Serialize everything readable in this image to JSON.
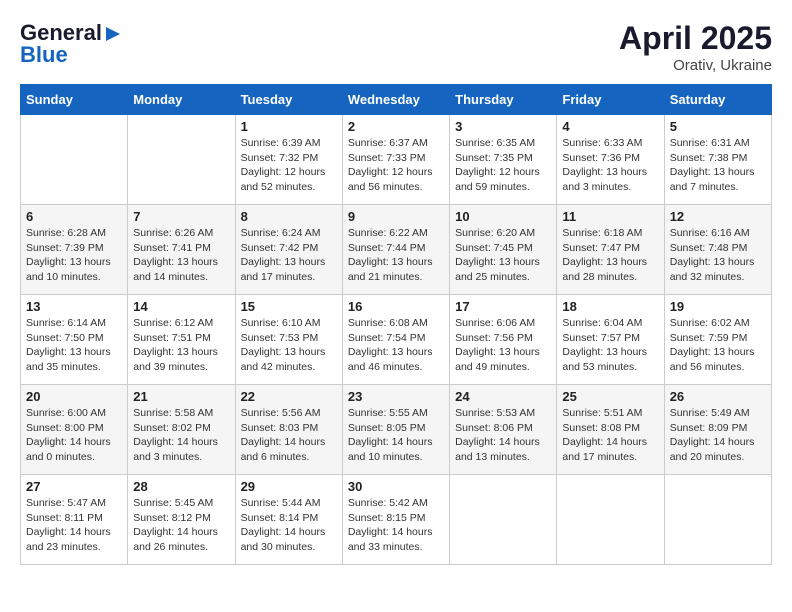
{
  "logo": {
    "general": "General",
    "blue": "Blue"
  },
  "title": "April 2025",
  "location": "Orativ, Ukraine",
  "days": [
    "Sunday",
    "Monday",
    "Tuesday",
    "Wednesday",
    "Thursday",
    "Friday",
    "Saturday"
  ],
  "weeks": [
    [
      {
        "day": "",
        "content": ""
      },
      {
        "day": "",
        "content": ""
      },
      {
        "day": "1",
        "content": "Sunrise: 6:39 AM\nSunset: 7:32 PM\nDaylight: 12 hours\nand 52 minutes."
      },
      {
        "day": "2",
        "content": "Sunrise: 6:37 AM\nSunset: 7:33 PM\nDaylight: 12 hours\nand 56 minutes."
      },
      {
        "day": "3",
        "content": "Sunrise: 6:35 AM\nSunset: 7:35 PM\nDaylight: 12 hours\nand 59 minutes."
      },
      {
        "day": "4",
        "content": "Sunrise: 6:33 AM\nSunset: 7:36 PM\nDaylight: 13 hours\nand 3 minutes."
      },
      {
        "day": "5",
        "content": "Sunrise: 6:31 AM\nSunset: 7:38 PM\nDaylight: 13 hours\nand 7 minutes."
      }
    ],
    [
      {
        "day": "6",
        "content": "Sunrise: 6:28 AM\nSunset: 7:39 PM\nDaylight: 13 hours\nand 10 minutes."
      },
      {
        "day": "7",
        "content": "Sunrise: 6:26 AM\nSunset: 7:41 PM\nDaylight: 13 hours\nand 14 minutes."
      },
      {
        "day": "8",
        "content": "Sunrise: 6:24 AM\nSunset: 7:42 PM\nDaylight: 13 hours\nand 17 minutes."
      },
      {
        "day": "9",
        "content": "Sunrise: 6:22 AM\nSunset: 7:44 PM\nDaylight: 13 hours\nand 21 minutes."
      },
      {
        "day": "10",
        "content": "Sunrise: 6:20 AM\nSunset: 7:45 PM\nDaylight: 13 hours\nand 25 minutes."
      },
      {
        "day": "11",
        "content": "Sunrise: 6:18 AM\nSunset: 7:47 PM\nDaylight: 13 hours\nand 28 minutes."
      },
      {
        "day": "12",
        "content": "Sunrise: 6:16 AM\nSunset: 7:48 PM\nDaylight: 13 hours\nand 32 minutes."
      }
    ],
    [
      {
        "day": "13",
        "content": "Sunrise: 6:14 AM\nSunset: 7:50 PM\nDaylight: 13 hours\nand 35 minutes."
      },
      {
        "day": "14",
        "content": "Sunrise: 6:12 AM\nSunset: 7:51 PM\nDaylight: 13 hours\nand 39 minutes."
      },
      {
        "day": "15",
        "content": "Sunrise: 6:10 AM\nSunset: 7:53 PM\nDaylight: 13 hours\nand 42 minutes."
      },
      {
        "day": "16",
        "content": "Sunrise: 6:08 AM\nSunset: 7:54 PM\nDaylight: 13 hours\nand 46 minutes."
      },
      {
        "day": "17",
        "content": "Sunrise: 6:06 AM\nSunset: 7:56 PM\nDaylight: 13 hours\nand 49 minutes."
      },
      {
        "day": "18",
        "content": "Sunrise: 6:04 AM\nSunset: 7:57 PM\nDaylight: 13 hours\nand 53 minutes."
      },
      {
        "day": "19",
        "content": "Sunrise: 6:02 AM\nSunset: 7:59 PM\nDaylight: 13 hours\nand 56 minutes."
      }
    ],
    [
      {
        "day": "20",
        "content": "Sunrise: 6:00 AM\nSunset: 8:00 PM\nDaylight: 14 hours\nand 0 minutes."
      },
      {
        "day": "21",
        "content": "Sunrise: 5:58 AM\nSunset: 8:02 PM\nDaylight: 14 hours\nand 3 minutes."
      },
      {
        "day": "22",
        "content": "Sunrise: 5:56 AM\nSunset: 8:03 PM\nDaylight: 14 hours\nand 6 minutes."
      },
      {
        "day": "23",
        "content": "Sunrise: 5:55 AM\nSunset: 8:05 PM\nDaylight: 14 hours\nand 10 minutes."
      },
      {
        "day": "24",
        "content": "Sunrise: 5:53 AM\nSunset: 8:06 PM\nDaylight: 14 hours\nand 13 minutes."
      },
      {
        "day": "25",
        "content": "Sunrise: 5:51 AM\nSunset: 8:08 PM\nDaylight: 14 hours\nand 17 minutes."
      },
      {
        "day": "26",
        "content": "Sunrise: 5:49 AM\nSunset: 8:09 PM\nDaylight: 14 hours\nand 20 minutes."
      }
    ],
    [
      {
        "day": "27",
        "content": "Sunrise: 5:47 AM\nSunset: 8:11 PM\nDaylight: 14 hours\nand 23 minutes."
      },
      {
        "day": "28",
        "content": "Sunrise: 5:45 AM\nSunset: 8:12 PM\nDaylight: 14 hours\nand 26 minutes."
      },
      {
        "day": "29",
        "content": "Sunrise: 5:44 AM\nSunset: 8:14 PM\nDaylight: 14 hours\nand 30 minutes."
      },
      {
        "day": "30",
        "content": "Sunrise: 5:42 AM\nSunset: 8:15 PM\nDaylight: 14 hours\nand 33 minutes."
      },
      {
        "day": "",
        "content": ""
      },
      {
        "day": "",
        "content": ""
      },
      {
        "day": "",
        "content": ""
      }
    ]
  ]
}
